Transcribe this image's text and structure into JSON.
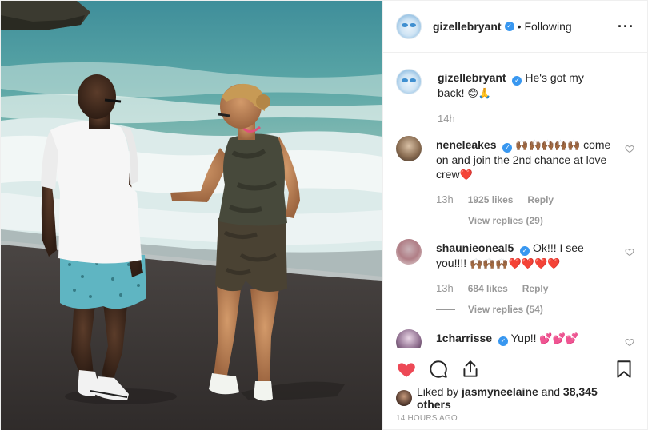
{
  "header": {
    "username": "gizellebryant",
    "dot": "•",
    "follow_status": "Following",
    "more_label": "···"
  },
  "caption": {
    "username": "gizellebryant",
    "text": "He's got my back!",
    "emojis": "😊🙏",
    "time": "14h"
  },
  "comments": [
    {
      "username": "neneleakes",
      "emoji_prefix": "🙌🏾🙌🏾🙌🏾🙌🏾🙌🏾",
      "text": "come on and join the 2nd chance at love crew",
      "emoji_suffix": "❤️",
      "time": "13h",
      "likes": "1925 likes",
      "reply_label": "Reply",
      "view_replies": "View replies (29)"
    },
    {
      "username": "shaunieoneal5",
      "text": "Ok!!! I see you!!!!",
      "emoji_suffix": "🙌🏾🙌🏾🙌🏾❤️❤️❤️❤️",
      "time": "13h",
      "likes": "684 likes",
      "reply_label": "Reply",
      "view_replies": "View replies (54)"
    },
    {
      "username": "1charrisse",
      "text": "Yup!!",
      "emoji_suffix": "💕💕💕"
    }
  ],
  "liked_by": {
    "prefix": "Liked by",
    "user": "jasmyneelaine",
    "middle": "and",
    "count": "38,345 others"
  },
  "timestamp": "14 HOURS AGO",
  "colors": {
    "heart_filled": "#ed4956",
    "verified": "#3897f0",
    "muted": "#999999"
  },
  "icons": [
    "more-icon",
    "verified-icon",
    "heart-icon",
    "comment-icon",
    "share-icon",
    "bookmark-icon"
  ]
}
